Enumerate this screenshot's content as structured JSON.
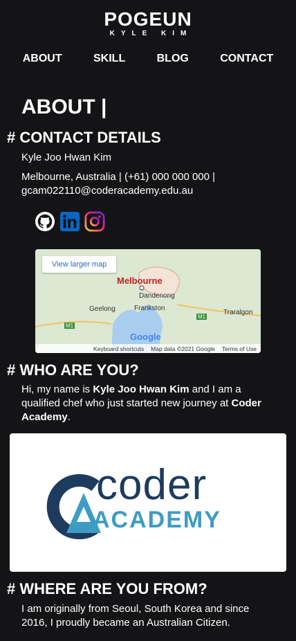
{
  "header": {
    "logo_main": "POGEUN",
    "logo_sub": "KYLE KIM"
  },
  "nav": [
    "ABOUT",
    "SKILL",
    "BLOG",
    "CONTACT"
  ],
  "page_title": "ABOUT |",
  "contact": {
    "heading": "# CONTACT DETAILS",
    "name": "Kyle Joo Hwan Kim",
    "details": "Melbourne, Australia | (+61) 000 000 000 | gcam022110@coderacademy.edu.au"
  },
  "social_icons": [
    "github-icon",
    "linkedin-icon",
    "instagram-icon"
  ],
  "map": {
    "view_larger": "View larger map",
    "labels": {
      "melbourne": "Melbourne",
      "dandenong": "Dandenong",
      "geelong": "Geelong",
      "frankston": "Frankston",
      "traralgon": "Traralgon",
      "m1_left": "M1",
      "m1_right": "M1"
    },
    "google": "Google",
    "footer": [
      "Keyboard shortcuts",
      "Map data ©2021 Google",
      "Terms of Use"
    ]
  },
  "who": {
    "heading": "# WHO ARE YOU?",
    "p1": "Hi, my name is ",
    "name": "Kyle Joo Hwan Kim",
    "p2": " and I am a qualified chef who just started new journey at ",
    "org": "Coder Academy",
    "p3": "."
  },
  "coder_logo": {
    "word1": "coder",
    "word2": "ACADEMY"
  },
  "where": {
    "heading": "# WHERE ARE YOU FROM?",
    "text": "I am originally from Seoul, South Korea and since 2016, I proudly became an Australian Citizen."
  },
  "colors": {
    "background": "#141416",
    "text": "#ffffff",
    "map_link": "#2a6ac0",
    "coder_navy": "#1c3b5e",
    "coder_blue": "#3e9bc4"
  }
}
